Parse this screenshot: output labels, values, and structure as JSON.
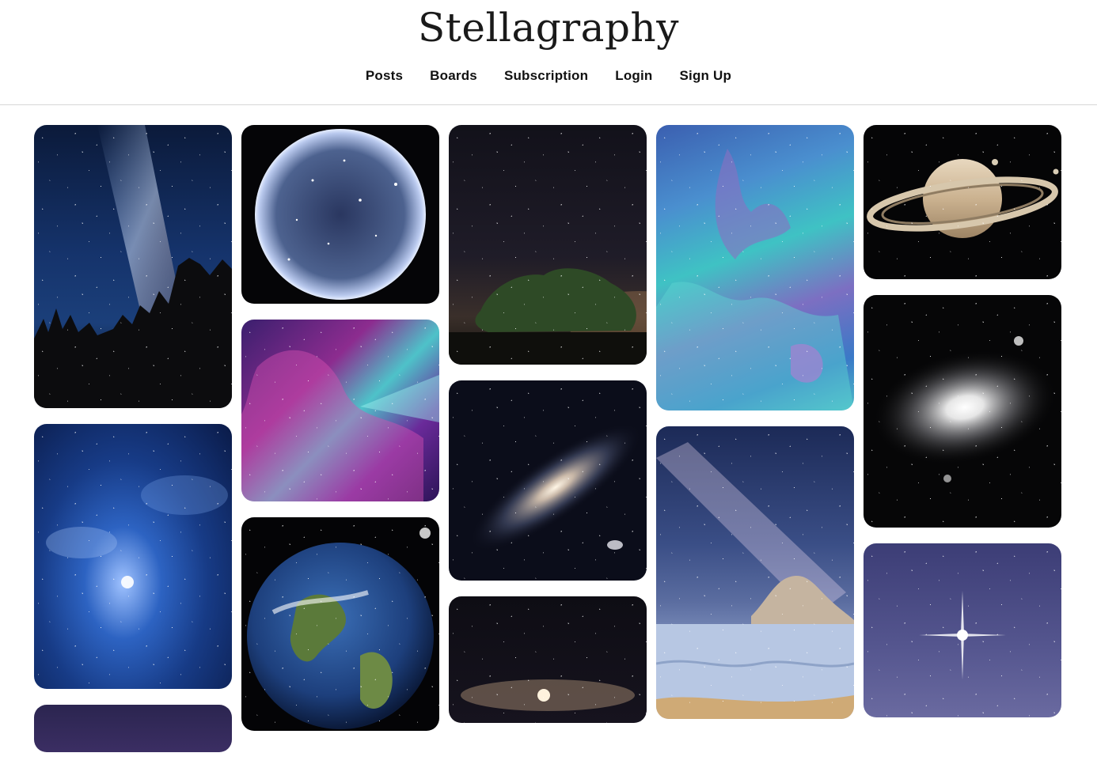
{
  "site": {
    "title": "Stellagraphy"
  },
  "nav": {
    "posts": "Posts",
    "boards": "Boards",
    "subscription": "Subscription",
    "login": "Login",
    "sign_up": "Sign Up"
  },
  "tiles": [
    {
      "subject": "milky-way-forest"
    },
    {
      "subject": "blue-nebula"
    },
    {
      "subject": "glass-sphere-stars"
    },
    {
      "subject": "pink-purple-nebula"
    },
    {
      "subject": "earth"
    },
    {
      "subject": "tree-night-sky"
    },
    {
      "subject": "andromeda-galaxy"
    },
    {
      "subject": "spiral-galaxy"
    },
    {
      "subject": "teal-nebula"
    },
    {
      "subject": "milky-way-desert"
    },
    {
      "subject": "saturn"
    },
    {
      "subject": "gray-galaxy"
    },
    {
      "subject": "bright-star"
    }
  ]
}
